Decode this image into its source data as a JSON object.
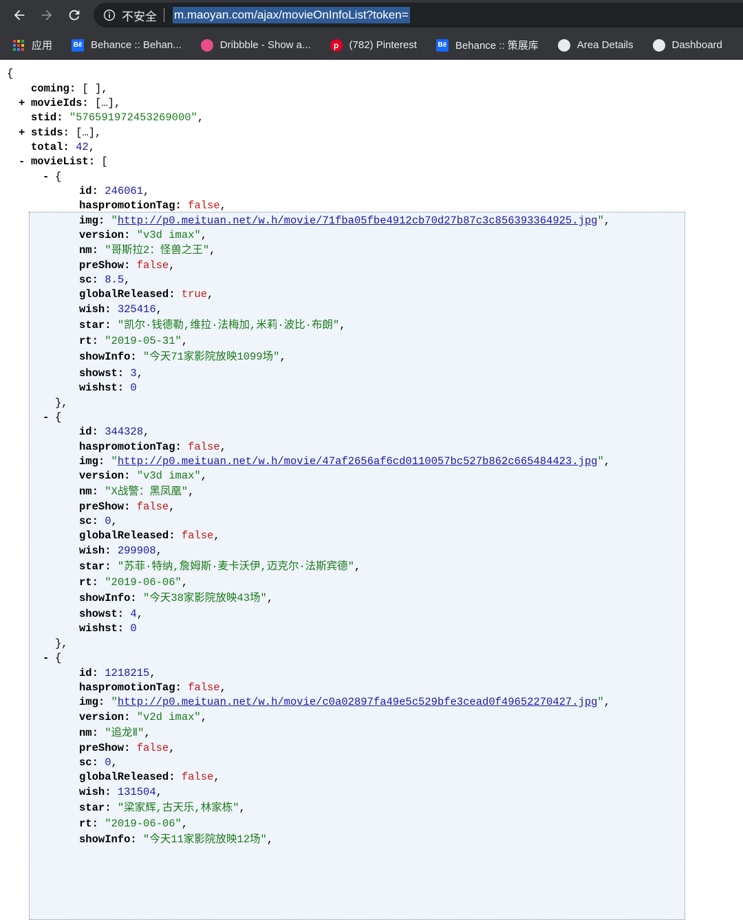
{
  "toolbar": {
    "back_icon": "arrow-left-icon",
    "forward_icon": "arrow-right-icon",
    "reload_icon": "reload-icon",
    "info_icon": "info-icon",
    "security_label": "不安全",
    "url": "m.maoyan.com/ajax/movieOnInfoList?token="
  },
  "bookmarks": {
    "apps_label": "应用",
    "items": [
      {
        "label": "Behance :: Behan...",
        "icon": "behance-icon"
      },
      {
        "label": "Dribbble - Show a...",
        "icon": "dribbble-icon"
      },
      {
        "label": "(782) Pinterest",
        "icon": "pinterest-icon"
      },
      {
        "label": "Behance :: 策展库",
        "icon": "behance-icon"
      },
      {
        "label": "Area Details",
        "icon": "globe-icon"
      },
      {
        "label": "Dashboard",
        "icon": "globe-icon"
      }
    ]
  },
  "colors": {
    "string": "#1a7a1a",
    "number": "#1a1aa6",
    "boolean": "#c41a16",
    "chrome_bg": "#35363a",
    "selection_bg": "#2f5b95"
  },
  "json": {
    "open_brace": "{",
    "coming": "coming",
    "coming_val": "[ ]",
    "movieIds": "movieIds",
    "movieIds_val": "[…]",
    "stid": "stid",
    "stid_val": "\"576591972453269000\"",
    "stids": "stids",
    "stids_val": "[…]",
    "total": "total",
    "total_val": "42",
    "movieList": "movieList",
    "movieList_open": "[",
    "movies": [
      {
        "id": "246061",
        "haspromotionTag": "false",
        "img": "http://p0.meituan.net/w.h/movie/71fba05fbe4912cb70d27b87c3c856393364925.jpg",
        "version": "\"v3d imax\"",
        "nm": "\"哥斯拉2：怪兽之王\"",
        "preShow": "false",
        "sc": "8.5",
        "globalReleased": "true",
        "wish": "325416",
        "star": "\"凯尔·钱德勒,维拉·法梅加,米莉·波比·布朗\"",
        "rt": "\"2019-05-31\"",
        "showInfo": "\"今天71家影院放映1099场\"",
        "showst": "3",
        "wishst": "0"
      },
      {
        "id": "344328",
        "haspromotionTag": "false",
        "img": "http://p0.meituan.net/w.h/movie/47af2656af6cd0110057bc527b862c665484423.jpg",
        "version": "\"v3d imax\"",
        "nm": "\"X战警：黑凤凰\"",
        "preShow": "false",
        "sc": "0",
        "globalReleased": "false",
        "wish": "299908",
        "star": "\"苏菲·特纳,詹姆斯·麦卡沃伊,迈克尔·法斯宾德\"",
        "rt": "\"2019-06-06\"",
        "showInfo": "\"今天38家影院放映43场\"",
        "showst": "4",
        "wishst": "0"
      },
      {
        "id": "1218215",
        "haspromotionTag": "false",
        "img": "http://p0.meituan.net/w.h/movie/c0a02897fa49e5c529bfe3cead0f49652270427.jpg",
        "version": "\"v2d imax\"",
        "nm": "\"追龙Ⅱ\"",
        "preShow": "false",
        "sc": "0",
        "globalReleased": "false",
        "wish": "131504",
        "star": "\"梁家辉,古天乐,林家栋\"",
        "rt": "\"2019-06-06\"",
        "showInfo": "\"今天11家影院放映12场\""
      }
    ]
  }
}
